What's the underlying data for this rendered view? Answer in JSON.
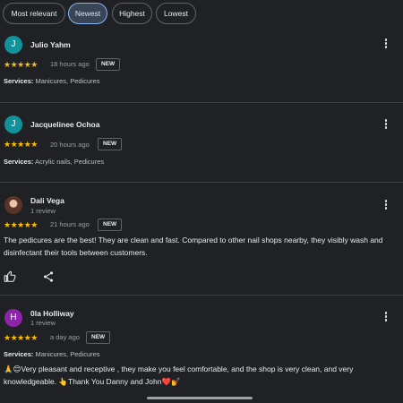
{
  "filters": [
    {
      "label": "Most relevant",
      "active": false
    },
    {
      "label": "Newest",
      "active": true
    },
    {
      "label": "Highest",
      "active": false
    },
    {
      "label": "Lowest",
      "active": false
    }
  ],
  "colors": {
    "star": "#fbbc04",
    "accent": "#8ab4f8",
    "teal_avatar": "#12939b",
    "purple_avatar": "#8e24aa"
  },
  "reviews": [
    {
      "initial": "J",
      "name": "Julio Yahm",
      "stars": "★★★★★",
      "rating": 5,
      "time": "18 hours ago",
      "badge": "NEW",
      "services_label": "Services:",
      "services": " Manicures, Pedicures"
    },
    {
      "initial": "J",
      "name": "Jacquelinee Ochoa",
      "stars": "★★★★★",
      "rating": 5,
      "time": "20 hours ago",
      "badge": "NEW",
      "services_label": "Services:",
      "services": " Acrylic nails, Pedicures"
    },
    {
      "name": "Dali Vega",
      "meta": "1 review",
      "stars": "★★★★★",
      "rating": 5,
      "time": "21 hours ago",
      "badge": "NEW",
      "text": "The pedicures are the best! They are clean and fast. Compared to other nail shops nearby, they visibly wash and disinfectant their tools between customers.",
      "avatar_icon": "profile-photo"
    },
    {
      "initial": "H",
      "name": "0la Holliway",
      "meta": "1 review",
      "stars": "★★★★★",
      "rating": 5,
      "time": "a day ago",
      "badge": "NEW",
      "services_label": "Services:",
      "services": " Manicures, Pedicures",
      "text": "🙏😊Very pleasant and receptive , they make you feel comfortable, and the shop is very clean, and very knowledgeable. 👆Thank You Danny and John❤️💅"
    }
  ],
  "icons": [
    "more-vert-icon",
    "thumbs-up-icon",
    "share-icon"
  ]
}
